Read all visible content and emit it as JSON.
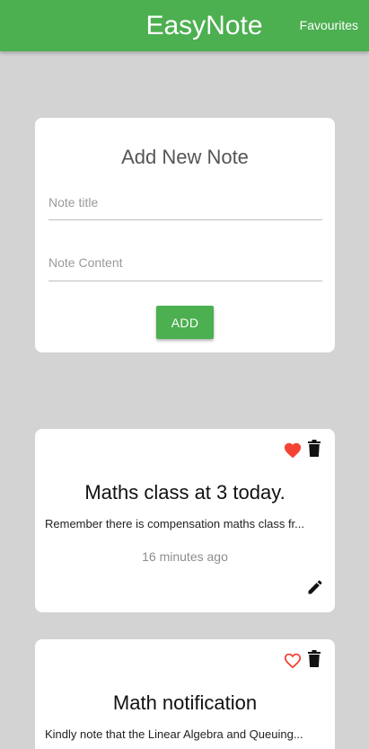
{
  "header": {
    "brand": "EasyNote",
    "favourites_label": "Favourites",
    "color": "#4caf50"
  },
  "add_note": {
    "heading": "Add New Note",
    "title_placeholder": "Note title",
    "title_value": "",
    "content_placeholder": "Note Content",
    "content_value": "",
    "button_label": "ADD"
  },
  "notes": [
    {
      "title": "Maths class at 3 today.",
      "content": "Remember there is compensation maths class fr...",
      "time": "16 minutes ago",
      "favourite": true,
      "icons": [
        "heart-filled-icon",
        "trash-icon",
        "pencil-icon"
      ]
    },
    {
      "title": "Math notification",
      "content": "Kindly note that the Linear Algebra and Queuing...",
      "favourite": false,
      "icons": [
        "heart-outline-icon",
        "trash-icon"
      ]
    }
  ],
  "colors": {
    "background": "#d3d3d3",
    "favourite": "#f44336"
  }
}
